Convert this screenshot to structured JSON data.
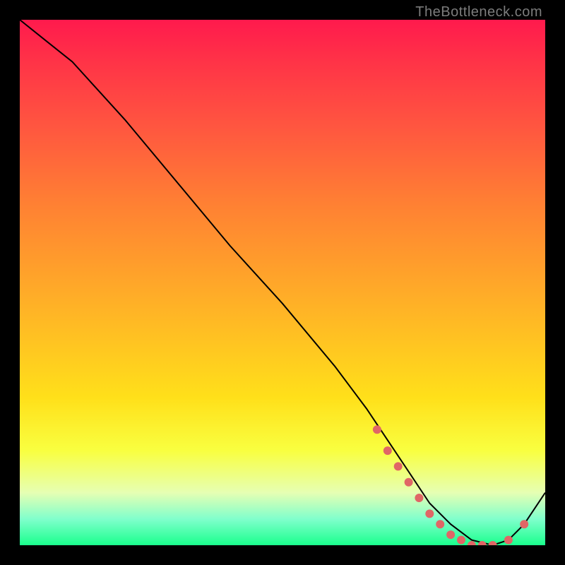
{
  "watermark": "TheBottleneck.com",
  "colors": {
    "background": "#000000",
    "gradient_top": "#ff1a4d",
    "gradient_bottom": "#1aff8d",
    "curve": "#000000",
    "marker": "#e06666"
  },
  "chart_data": {
    "type": "line",
    "title": "",
    "xlabel": "",
    "ylabel": "",
    "xlim": [
      0,
      100
    ],
    "ylim": [
      0,
      100
    ],
    "series": [
      {
        "name": "bottleneck-curve",
        "x": [
          0,
          5,
          10,
          20,
          30,
          40,
          50,
          60,
          66,
          70,
          74,
          78,
          82,
          86,
          90,
          93,
          96,
          100
        ],
        "y": [
          100,
          96,
          92,
          81,
          69,
          57,
          46,
          34,
          26,
          20,
          14,
          8,
          4,
          1,
          0,
          1,
          4,
          10
        ]
      }
    ],
    "markers": {
      "name": "highlight-points",
      "x": [
        68,
        70,
        72,
        74,
        76,
        78,
        80,
        82,
        84,
        86,
        88,
        90,
        93,
        96
      ],
      "y": [
        22,
        18,
        15,
        12,
        9,
        6,
        4,
        2,
        1,
        0,
        0,
        0,
        1,
        4
      ]
    }
  }
}
